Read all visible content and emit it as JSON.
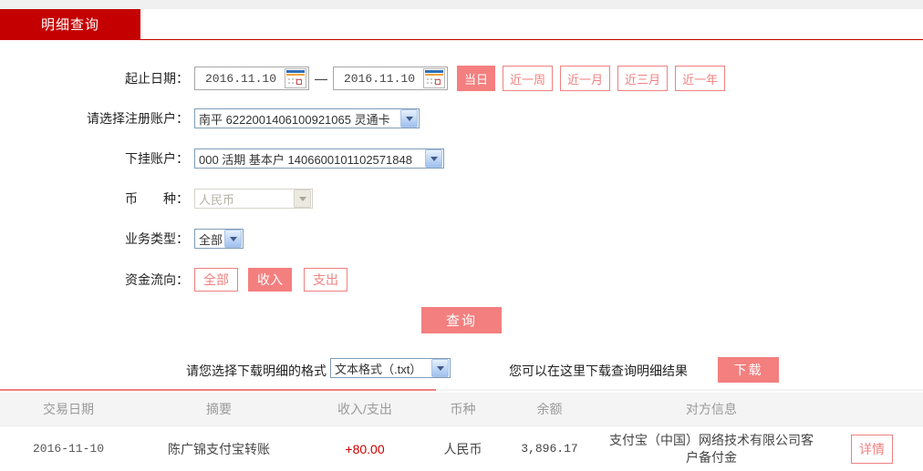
{
  "tab": {
    "title": "明细查询"
  },
  "form": {
    "date_range": {
      "label": "起止日期：",
      "start": "2016.11.10",
      "separator": "—",
      "end": "2016.11.10",
      "quick_buttons": [
        {
          "label": "当日",
          "active": true
        },
        {
          "label": "近一周",
          "active": false
        },
        {
          "label": "近一月",
          "active": false
        },
        {
          "label": "近三月",
          "active": false
        },
        {
          "label": "近一年",
          "active": false
        }
      ]
    },
    "register_account": {
      "label": "请选择注册账户：",
      "value": "南平 6222001406100921065 灵通卡"
    },
    "sub_account": {
      "label": "下挂账户：",
      "value": "000 活期 基本户 1406600101102571848"
    },
    "currency": {
      "label": "币　　种：",
      "value": "人民币",
      "disabled": true
    },
    "business_type": {
      "label": "业务类型：",
      "value": "全部"
    },
    "fund_flow": {
      "label": "资金流向：",
      "options": [
        {
          "label": "全部",
          "active": false
        },
        {
          "label": "收入",
          "active": true
        },
        {
          "label": "支出",
          "active": false
        }
      ]
    },
    "query_button": "查询"
  },
  "download": {
    "format_label": "请您选择下载明细的格式",
    "format_value": "文本格式（.txt）",
    "hint": "您可以在这里下载查询明细结果",
    "button": "下载"
  },
  "table": {
    "headers": [
      "交易日期",
      "摘要",
      "收入/支出",
      "币种",
      "余额",
      "对方信息"
    ],
    "rows": [
      {
        "date": "2016-11-10",
        "summary": "陈广锦支付宝转账",
        "amount": "+80.00",
        "currency": "人民币",
        "balance": "3,896.17",
        "counterparty": "支付宝（中国）网络技术有限公司客户备付金",
        "action": "详情"
      }
    ]
  },
  "colors": {
    "brand_red": "#c40000",
    "accent_salmon_fill": "#f47f7f",
    "accent_salmon_border": "#f08080",
    "amount_income_red": "#cc0000",
    "table_header_bg": "#f4f4f4",
    "table_header_text": "#9a9a9a"
  }
}
